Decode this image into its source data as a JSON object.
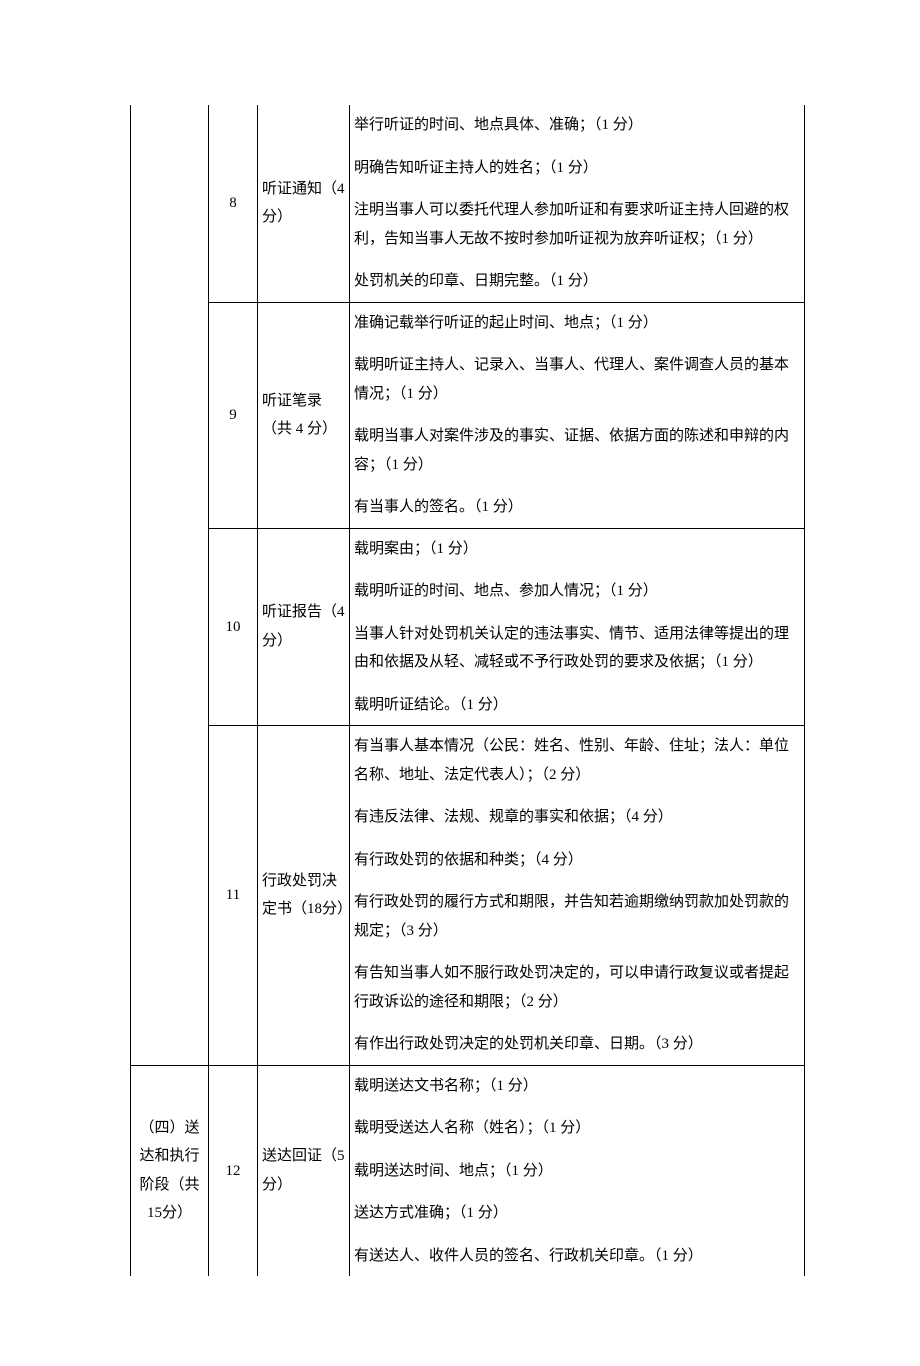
{
  "rows": [
    {
      "section": "",
      "num": "8",
      "item": "听证通知（4 分）",
      "details": [
        "举行听证的时间、地点具体、准确；（1 分）",
        "明确告知听证主持人的姓名；（1 分）",
        "注明当事人可以委托代理人参加听证和有要求听证主持人回避的权利，告知当事人无故不按时参加听证视为放弃听证权；（1 分）",
        "处罚机关的印章、日期完整。（1 分）"
      ]
    },
    {
      "num": "9",
      "item": "听证笔录（共 4 分）",
      "details": [
        "准确记载举行听证的起止时间、地点；（1 分）",
        "载明听证主持人、记录入、当事人、代理人、案件调查人员的基本情况；（1 分）",
        "载明当事人对案件涉及的事实、证据、依据方面的陈述和申辩的内容；（1 分）",
        "有当事人的签名。（1 分）"
      ]
    },
    {
      "num": "10",
      "item": "听证报告（4 分）",
      "details": [
        "载明案由；（1 分）",
        "载明听证的时间、地点、参加人情况；（1 分）",
        "当事人针对处罚机关认定的违法事实、情节、适用法律等提出的理由和依据及从轻、减轻或不予行政处罚的要求及依据；（1 分）",
        "载明听证结论。（1 分）"
      ]
    },
    {
      "num": "11",
      "item": "行政处罚决定书（18分）",
      "details": [
        "有当事人基本情况（公民：姓名、性别、年龄、住址；法人：单位名称、地址、法定代表人）；（2 分）",
        "有违反法律、法规、规章的事实和依据；（4 分）",
        "有行政处罚的依据和种类；（4 分）",
        "有行政处罚的履行方式和期限，并告知若逾期缴纳罚款加处罚款的规定；（3 分）",
        "有告知当事人如不服行政处罚决定的，可以申请行政复议或者提起行政诉讼的途径和期限；（2 分）",
        "有作出行政处罚决定的处罚机关印章、日期。（3 分）"
      ]
    },
    {
      "section": "（四）送达和执行阶段（共 15分）",
      "num": "12",
      "item": "送达回证（5 分）",
      "details": [
        "载明送达文书名称；（1 分）",
        "载明受送达人名称（姓名）；（1 分）",
        "载明送达时间、地点；（1 分）",
        "送达方式准确；（1 分）",
        "有送达人、收件人员的签名、行政机关印章。（1 分）"
      ]
    }
  ]
}
